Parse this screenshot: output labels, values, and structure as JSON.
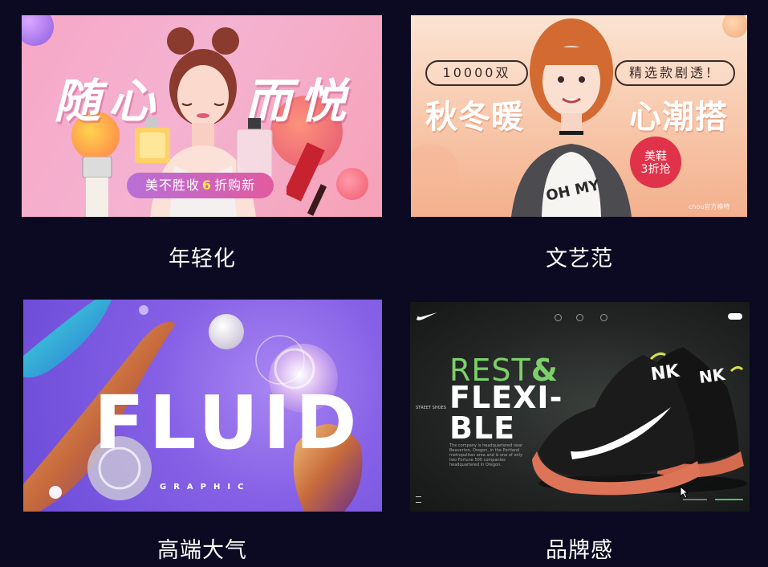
{
  "cards": [
    {
      "caption": "年轻化",
      "headline_chars": [
        "随",
        "心",
        "而",
        "悦"
      ],
      "banner": {
        "text_before": "美不胜收",
        "highlight": "6",
        "text_after": "折购新"
      }
    },
    {
      "caption": "文艺范",
      "pill_left": "10000双",
      "pill_right": "精选款剧透！",
      "headline_left": "秋冬暖",
      "headline_right": "心潮搭",
      "badge_line1": "美鞋",
      "badge_line2": "3折抢",
      "shirt_text": "OH MY",
      "watermark": "chou官方模特"
    },
    {
      "caption": "高端大气",
      "title": "FLUID",
      "subtitle": "GRAPHIC"
    },
    {
      "caption": "品牌感",
      "headline_green": "REST",
      "headline_amp": "&",
      "headline_line2": "FLEXI-",
      "headline_line3": "BLE",
      "side_label": "STREET SHOES",
      "body": "The company is headquartered near Beaverton, Oregon, in the Portland metropolitan area and is one of only two Fortune 500 companies headquartered in Oregon.",
      "shoe_text": "NK"
    }
  ],
  "colors": {
    "background": "#0b0a22",
    "card1_pink": "#f7a7c6",
    "card2_peach": "#f7c4a6",
    "card3_purple": "#8661e6",
    "card4_dark": "#232625",
    "nike_green": "#7bd06a"
  }
}
